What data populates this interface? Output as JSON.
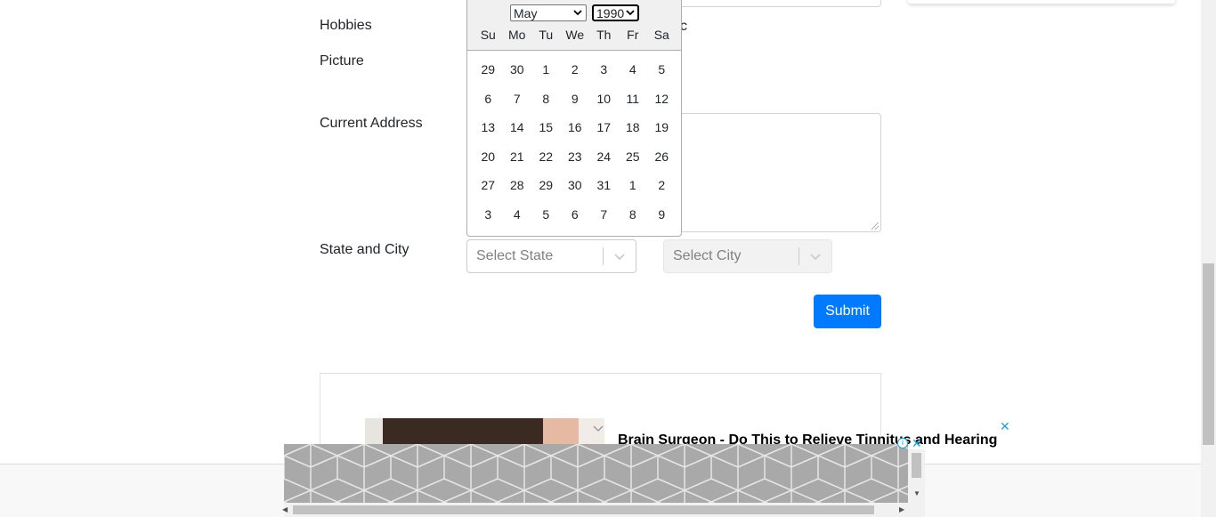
{
  "form": {
    "hobbies_label": "Hobbies",
    "hobby_tail": "c",
    "picture_label": "Picture",
    "address_label": "Current Address",
    "state_city_label": "State and City",
    "state_placeholder": "Select State",
    "city_placeholder": "Select City",
    "submit_label": "Submit"
  },
  "datepicker": {
    "month": "May",
    "year": "1990",
    "weekdays": [
      "Su",
      "Mo",
      "Tu",
      "We",
      "Th",
      "Fr",
      "Sa"
    ],
    "weeks": [
      [
        "29",
        "30",
        "1",
        "2",
        "3",
        "4",
        "5"
      ],
      [
        "6",
        "7",
        "8",
        "9",
        "10",
        "11",
        "12"
      ],
      [
        "13",
        "14",
        "15",
        "16",
        "17",
        "18",
        "19"
      ],
      [
        "20",
        "21",
        "22",
        "23",
        "24",
        "25",
        "26"
      ],
      [
        "27",
        "28",
        "29",
        "30",
        "31",
        "1",
        "2"
      ],
      [
        "3",
        "4",
        "5",
        "6",
        "7",
        "8",
        "9"
      ]
    ]
  },
  "ad": {
    "title": "Brain Surgeon - Do This to Relieve Tinnitus and Hearing",
    "info_icon": "info-icon",
    "close_icon": "close-icon"
  },
  "colors": {
    "primary": "#007bff",
    "ad_accent": "#1fa3d6"
  }
}
